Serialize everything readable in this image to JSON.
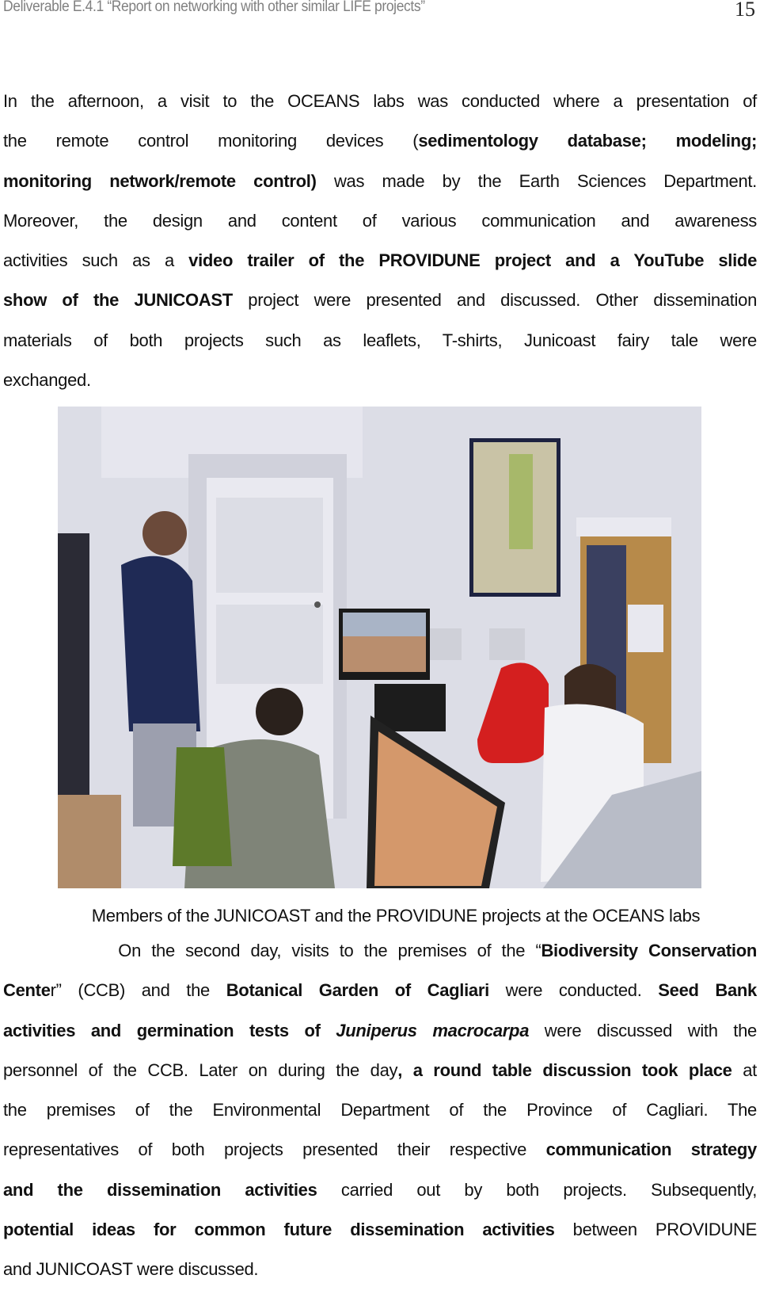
{
  "header": {
    "title": "Deliverable E.4.1  “Report on networking with other similar LIFE projects”",
    "page_number": "15"
  },
  "paragraph1": {
    "lines": [
      [
        {
          "t": "In the afternoon, a visit to the OCEANS labs was conducted where a presentation of",
          "b": false
        }
      ],
      [
        {
          "t": "the remote control monitoring devices (",
          "b": false
        },
        {
          "t": "sedimentology database; modeling;",
          "b": true
        }
      ],
      [
        {
          "t": "monitoring network/remote control)",
          "b": true
        },
        {
          "t": " was made by the Earth Sciences Department.",
          "b": false
        }
      ],
      [
        {
          "t": "Moreover, the design and content of various communication and awareness",
          "b": false
        }
      ],
      [
        {
          "t": "activities such as a ",
          "b": false
        },
        {
          "t": "video trailer of the PROVIDUNE project and a YouTube slide",
          "b": true
        }
      ],
      [
        {
          "t": "show of the JUNICOAST",
          "b": true
        },
        {
          "t": " project were presented and discussed. Other dissemination",
          "b": false
        }
      ],
      [
        {
          "t": "materials of both projects such as leaflets, T-shirts, Junicoast fairy tale were",
          "b": false
        }
      ],
      [
        {
          "t": "exchanged.",
          "b": false
        }
      ]
    ]
  },
  "figure": {
    "alt": "Photo of members in a lab office with computer monitors, a door, a map on the wall, a bookshelf and a red chair",
    "caption": "Members of the JUNICOAST and the PROVIDUNE projects at the OCEANS labs"
  },
  "paragraph2": {
    "lines": [
      [
        {
          "t": "           On the second day, visits to the premises of the “",
          "b": false
        },
        {
          "t": "Biodiversity Conservation",
          "b": true
        }
      ],
      [
        {
          "t": "Cente",
          "b": true
        },
        {
          "t": "r” (CCB) and the ",
          "b": false
        },
        {
          "t": "Botanical Garden of Cagliari",
          "b": true
        },
        {
          "t": " were conducted. ",
          "b": false
        },
        {
          "t": "Seed Bank",
          "b": true
        }
      ],
      [
        {
          "t": "activities and germination tests of ",
          "b": true
        },
        {
          "t": "Juniperus macrocarpa",
          "b": true,
          "i": true
        },
        {
          "t": " were discussed with the",
          "b": false
        }
      ],
      [
        {
          "t": "personnel of the CCB. Later on during the day",
          "b": false
        },
        {
          "t": ", a round table discussion took place",
          "b": true
        },
        {
          "t": " at",
          "b": false
        }
      ],
      [
        {
          "t": "the premises of the Environmental Department of the Province of Cagliari. The",
          "b": false
        }
      ],
      [
        {
          "t": "representatives of both projects presented their respective ",
          "b": false
        },
        {
          "t": "communication strategy",
          "b": true
        }
      ],
      [
        {
          "t": "and the dissemination activities",
          "b": true
        },
        {
          "t": " carried out by both projects. Subsequently,",
          "b": false
        }
      ],
      [
        {
          "t": "potential ideas for common future dissemination activities",
          "b": true
        },
        {
          "t": " between PROVIDUNE",
          "b": false
        }
      ],
      [
        {
          "t": "and JUNICOAST were discussed.",
          "b": false
        }
      ]
    ]
  }
}
